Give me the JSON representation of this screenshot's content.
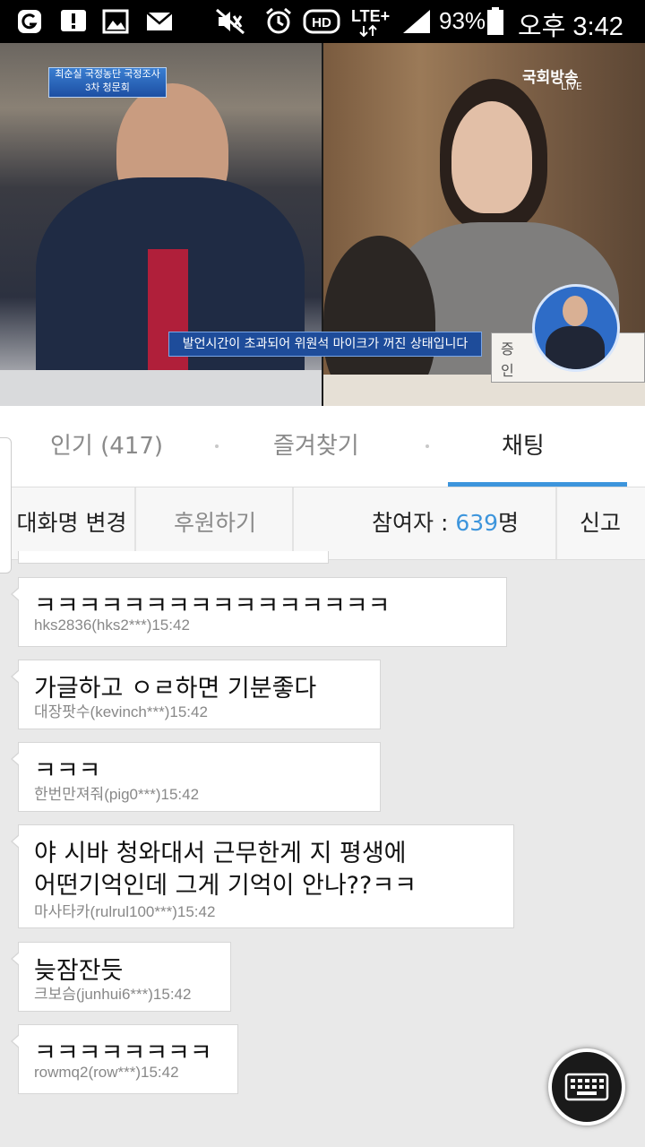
{
  "status_bar": {
    "battery": "93%",
    "time": "오후 3:42",
    "network": "LTE+",
    "hd": "HD",
    "icons": [
      "g-app-icon",
      "notification-alert-icon",
      "gallery-icon",
      "mail-icon",
      "mute-icon",
      "alarm-icon",
      "hd-voice-icon",
      "lte-icon",
      "signal-icon",
      "battery-icon"
    ]
  },
  "video": {
    "topic_line1": "최순실 국정농단 국정조사",
    "topic_line2": "3차 청문회",
    "broadcaster": "국회방송",
    "live": "LIVE",
    "caption": "발언시간이 초과되어 위원석 마이크가 꺼진 상태입니다",
    "nameplate_a": "증",
    "nameplate_b": "인"
  },
  "tabs": [
    {
      "label": "인기 (417)"
    },
    {
      "label": "즐겨찾기"
    },
    {
      "label": "채팅"
    }
  ],
  "actions": {
    "rename": "대화명 변경",
    "sponsor": "후원하기",
    "participants_label": "참여자 : ",
    "participants_count": "639",
    "participants_unit": "명",
    "report": "신고"
  },
  "messages": [
    {
      "text": "ㅋㅋㅋㅋㅋㅋㅋㅋㅋㅋㅋㅋㅋㅋㅋㅋ",
      "meta": "hks2836(hks2***)15:42"
    },
    {
      "text": "가글하고 ㅇㄹ하면 기분좋다",
      "meta": "대장팟수(kevinch***)15:42"
    },
    {
      "text": "ㅋㅋㅋ",
      "meta": "한번만져줘(pig0***)15:42"
    },
    {
      "text_line1": "야 시바 청와대서 근무한게 지 평생에",
      "text_line2": "어떤기억인데 그게 기억이 안나??ㅋㅋ",
      "meta": "마사타카(rulrul100***)15:42"
    },
    {
      "text": "늦잠잔듯",
      "meta": "크보슴(junhui6***)15:42"
    },
    {
      "text": "ㅋㅋㅋㅋㅋㅋㅋㅋ",
      "meta": "rowmq2(row***)15:42"
    }
  ],
  "colors": {
    "accent": "#3d95dc",
    "caption_bg": "#1e4c9a"
  }
}
